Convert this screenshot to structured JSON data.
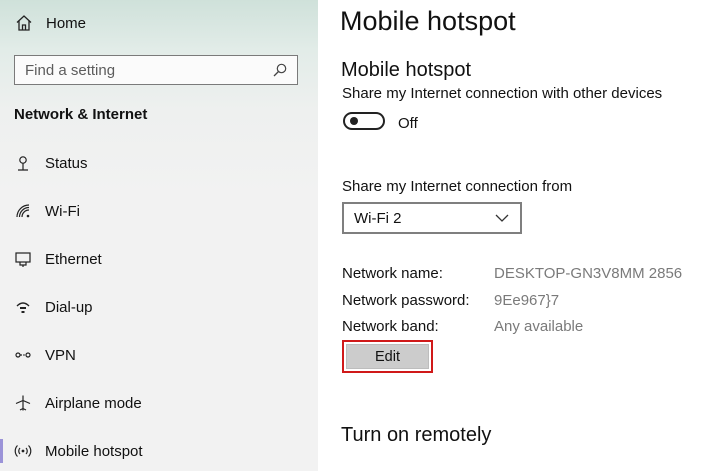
{
  "sidebar": {
    "home_label": "Home",
    "search_placeholder": "Find a setting",
    "section_title": "Network & Internet",
    "items": [
      {
        "label": "Status",
        "icon": "status-icon"
      },
      {
        "label": "Wi-Fi",
        "icon": "wifi-icon"
      },
      {
        "label": "Ethernet",
        "icon": "ethernet-icon"
      },
      {
        "label": "Dial-up",
        "icon": "dialup-icon"
      },
      {
        "label": "VPN",
        "icon": "vpn-icon"
      },
      {
        "label": "Airplane mode",
        "icon": "airplane-icon"
      },
      {
        "label": "Mobile hotspot",
        "icon": "hotspot-icon",
        "active": true
      }
    ]
  },
  "main": {
    "page_title": "Mobile hotspot",
    "section_title": "Mobile hotspot",
    "share_description": "Share my Internet connection with other devices",
    "toggle_state": "Off",
    "share_from_label": "Share my Internet connection from",
    "share_from_value": "Wi-Fi 2",
    "network_info": {
      "name_label": "Network name:",
      "name_value": "DESKTOP-GN3V8MM 2856",
      "password_label": "Network password:",
      "password_value": "9Ee967}7",
      "band_label": "Network band:",
      "band_value": "Any available"
    },
    "edit_label": "Edit",
    "remote_title": "Turn on remotely"
  },
  "colors": {
    "active_indicator": "#9b93d8",
    "highlight_border": "#d01919",
    "button_bg": "#cccccc",
    "value_text": "#7a7a7a"
  }
}
